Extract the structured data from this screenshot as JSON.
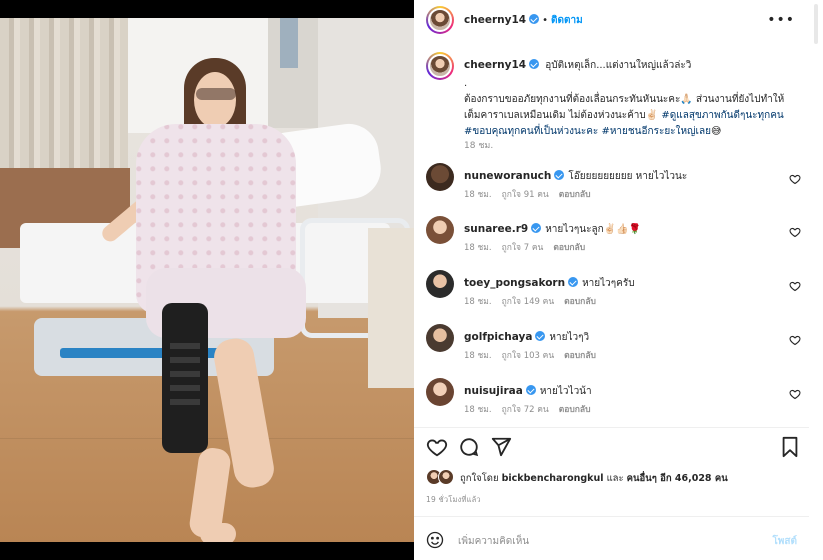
{
  "post": {
    "username": "cheerny14",
    "follow_label": "ติดตาม",
    "more_icon": "more-horizontal-icon",
    "caption_title": "อุบัติเหตุเล็ก...แต่งานใหญ่แล้วล่ะวิ",
    "caption_body_1": ".\nต้องกราบขออภัยทุกงานที่ต้องเลื่อนกระทันหันนะคะ🙏🏻 ส่วนงานที่ยังไปทำให้ เต็มคาราเบลเหมือนเดิม ไม่ต้องห่วงนะค้าบ✌🏻",
    "caption_hashtag_1": "#ดูแลสุขภาพกันดีๆนะทุกคน",
    "caption_hashtag_2": "#ขอบคุณทุกคนที่เป็นห่วงนะคะ",
    "caption_hashtag_3": "#หายชนอีกระยะใหญ่เลย",
    "caption_emoji_end": "😅",
    "caption_time": "18 ชม.",
    "verified_color": "#3897f0",
    "link_color": "#0095f6"
  },
  "comments": [
    {
      "username": "nuneworanuch",
      "text": "โอ๊ยยยยยยยยย หายไวไวนะ",
      "time": "18 ชม.",
      "likes": "ถูกใจ 91 คน",
      "reply": "ตอบกลับ"
    },
    {
      "username": "sunaree.r9",
      "text": "หายไวๆนะลูก✌🏻👍🏻🌹",
      "time": "18 ชม.",
      "likes": "ถูกใจ 7 คน",
      "reply": "ตอบกลับ"
    },
    {
      "username": "toey_pongsakorn",
      "text": "หายไวๆครับ",
      "time": "18 ชม.",
      "likes": "ถูกใจ 149 คน",
      "reply": "ตอบกลับ"
    },
    {
      "username": "golfpichaya",
      "text": "หายไวๆวิ",
      "time": "18 ชม.",
      "likes": "ถูกใจ 103 คน",
      "reply": "ตอบกลับ"
    },
    {
      "username": "nuisujiraa",
      "text": "หายไวไวน้า",
      "time": "18 ชม.",
      "likes": "ถูกใจ 72 คน",
      "reply": "ตอบกลับ"
    }
  ],
  "actions": {
    "like_icon": "heart-icon",
    "comment_icon": "comment-icon",
    "share_icon": "send-icon",
    "save_icon": "bookmark-icon"
  },
  "likes": {
    "prefix": "ถูกใจโดย",
    "user": "bickbencharongkul",
    "and": "และ",
    "others": "คนอื่นๆ อีก 46,028 คน"
  },
  "post_time": "19 ชั่วโมงที่แล้ว",
  "add_comment": {
    "emoji_icon": "smile-emoji-icon",
    "placeholder": "เพิ่มความคิดเห็น",
    "post_label": "โพสต์"
  }
}
